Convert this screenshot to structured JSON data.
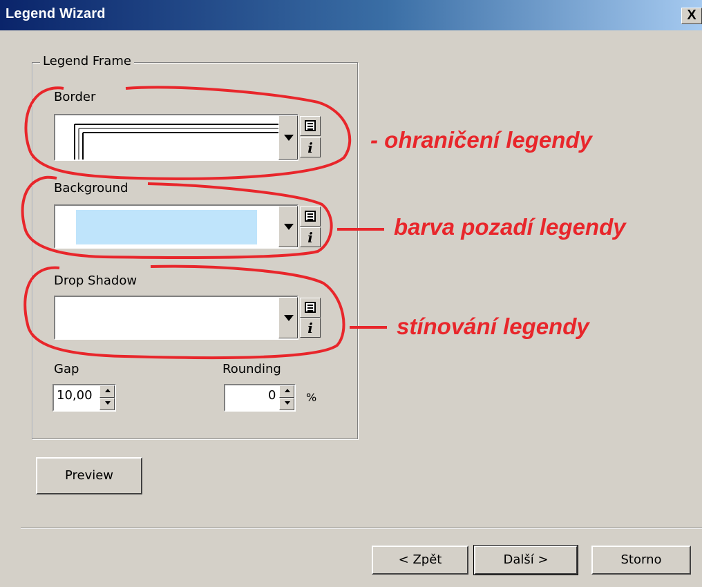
{
  "window": {
    "title": "Legend Wizard",
    "close_symbol": "X"
  },
  "group": {
    "label": "Legend Frame"
  },
  "fields": {
    "border_label": "Border",
    "background_label": "Background",
    "background_color": "#bfe4fb",
    "drop_shadow_label": "Drop Shadow",
    "gap_label": "Gap",
    "gap_value": "10,00",
    "rounding_label": "Rounding",
    "rounding_value": "0",
    "rounding_unit": "%"
  },
  "buttons": {
    "preview": "Preview",
    "back": "< Zpět",
    "next": "Další >",
    "cancel": "Storno"
  },
  "annotations": {
    "border_note": "- ohraničení legendy",
    "background_note": "barva pozadí legendy",
    "shadow_note": "stínování legendy",
    "color": "#e8262b"
  }
}
